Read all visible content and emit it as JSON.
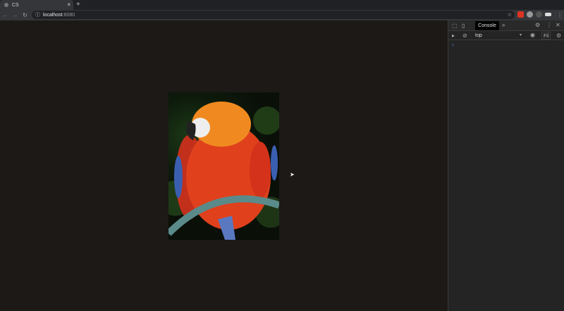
{
  "browser": {
    "tab_title": "CS",
    "url_host": "localhost",
    "url_port": ":8080"
  },
  "devtools": {
    "active_tab": "Console",
    "more": "»",
    "context": "top",
    "filter_label": "Fil",
    "prompt": "›"
  }
}
